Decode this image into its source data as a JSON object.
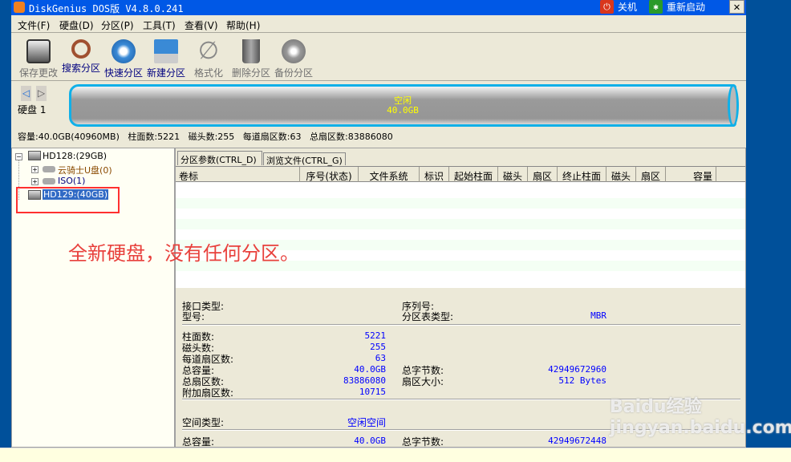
{
  "title": "DiskGenius DOS版 V4.8.0.241",
  "title_buttons": {
    "shutdown": "关机",
    "restart": "重新启动",
    "close": "✕"
  },
  "menu": [
    "文件(F)",
    "硬盘(D)",
    "分区(P)",
    "工具(T)",
    "查看(V)",
    "帮助(H)"
  ],
  "toolbar": [
    {
      "label": "保存更改",
      "enabled": false,
      "icon": "save-icon"
    },
    {
      "label": "搜索分区",
      "enabled": true,
      "icon": "search-icon"
    },
    {
      "label": "快速分区",
      "enabled": true,
      "icon": "quick-partition-icon"
    },
    {
      "label": "新建分区",
      "enabled": true,
      "icon": "new-partition-icon"
    },
    {
      "label": "格式化",
      "enabled": false,
      "icon": "format-icon"
    },
    {
      "label": "删除分区",
      "enabled": false,
      "icon": "trash-icon"
    },
    {
      "label": "备份分区",
      "enabled": false,
      "icon": "backup-icon"
    }
  ],
  "disk": {
    "label": "硬盘 1",
    "bar_label": "空闲",
    "bar_size": "40.0GB",
    "info": [
      "容量:40.0GB(40960MB)",
      "柱面数:5221",
      "磁头数:255",
      "每道扇区数:63",
      "总扇区数:83886080"
    ]
  },
  "tree": {
    "hd128": "HD128:(29GB)",
    "child1": "云骑士U盘(0)",
    "child2": "ISO(1)",
    "hd129": "HD129:(40GB)"
  },
  "tabs": [
    "分区参数(CTRL_D)",
    "浏览文件(CTRL_G)"
  ],
  "columns": [
    "卷标",
    "序号(状态)",
    "文件系统",
    "标识",
    "起始柱面",
    "磁头",
    "扇区",
    "终止柱面",
    "磁头",
    "扇区",
    "容量"
  ],
  "annotation": "全新硬盘，没有任何分区。",
  "details": {
    "interface_label": "接口类型:",
    "model_label": "型号:",
    "serial_label": "序列号:",
    "pt_type_label": "分区表类型:",
    "pt_type": "MBR",
    "rows": [
      {
        "label": "柱面数:",
        "value": "5221"
      },
      {
        "label": "磁头数:",
        "value": "255"
      },
      {
        "label": "每道扇区数:",
        "value": "63"
      },
      {
        "label": "总容量:",
        "value": "40.0GB",
        "label2": "总字节数:",
        "value2": "42949672960"
      },
      {
        "label": "总扇区数:",
        "value": "83886080",
        "label2": "扇区大小:",
        "value2": "512 Bytes"
      },
      {
        "label": "附加扇区数:",
        "value": "10715"
      }
    ],
    "space_type_label": "空间类型:",
    "space_type": "空闲空间",
    "free_capacity_label": "总容量:",
    "free_capacity": "40.0GB",
    "free_bytes_label": "总字节数:",
    "free_bytes": "42949672448"
  },
  "watermark": "Baidu经验 jingyan.baidu.com"
}
